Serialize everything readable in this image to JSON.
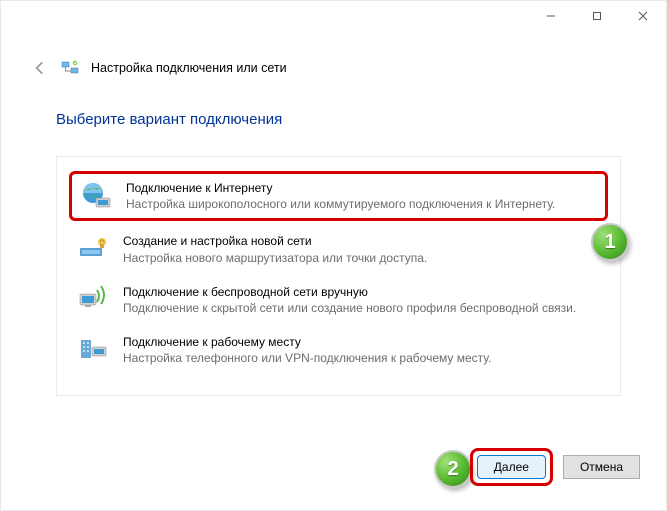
{
  "window": {
    "minimize": "−",
    "maximize": "□",
    "close": "×"
  },
  "header": {
    "title": "Настройка подключения или сети"
  },
  "heading": "Выберите вариант подключения",
  "options": [
    {
      "title": "Подключение к Интернету",
      "desc": "Настройка широкополосного или коммутируемого подключения к Интернету.",
      "selected": true
    },
    {
      "title": "Создание и настройка новой сети",
      "desc": "Настройка нового маршрутизатора или точки доступа."
    },
    {
      "title": "Подключение к беспроводной сети вручную",
      "desc": "Подключение к скрытой сети или создание нового профиля беспроводной связи."
    },
    {
      "title": "Подключение к рабочему месту",
      "desc": "Настройка телефонного или VPN-подключения к рабочему месту."
    }
  ],
  "buttons": {
    "next": "Далее",
    "cancel": "Отмена"
  },
  "badges": {
    "one": "1",
    "two": "2"
  }
}
